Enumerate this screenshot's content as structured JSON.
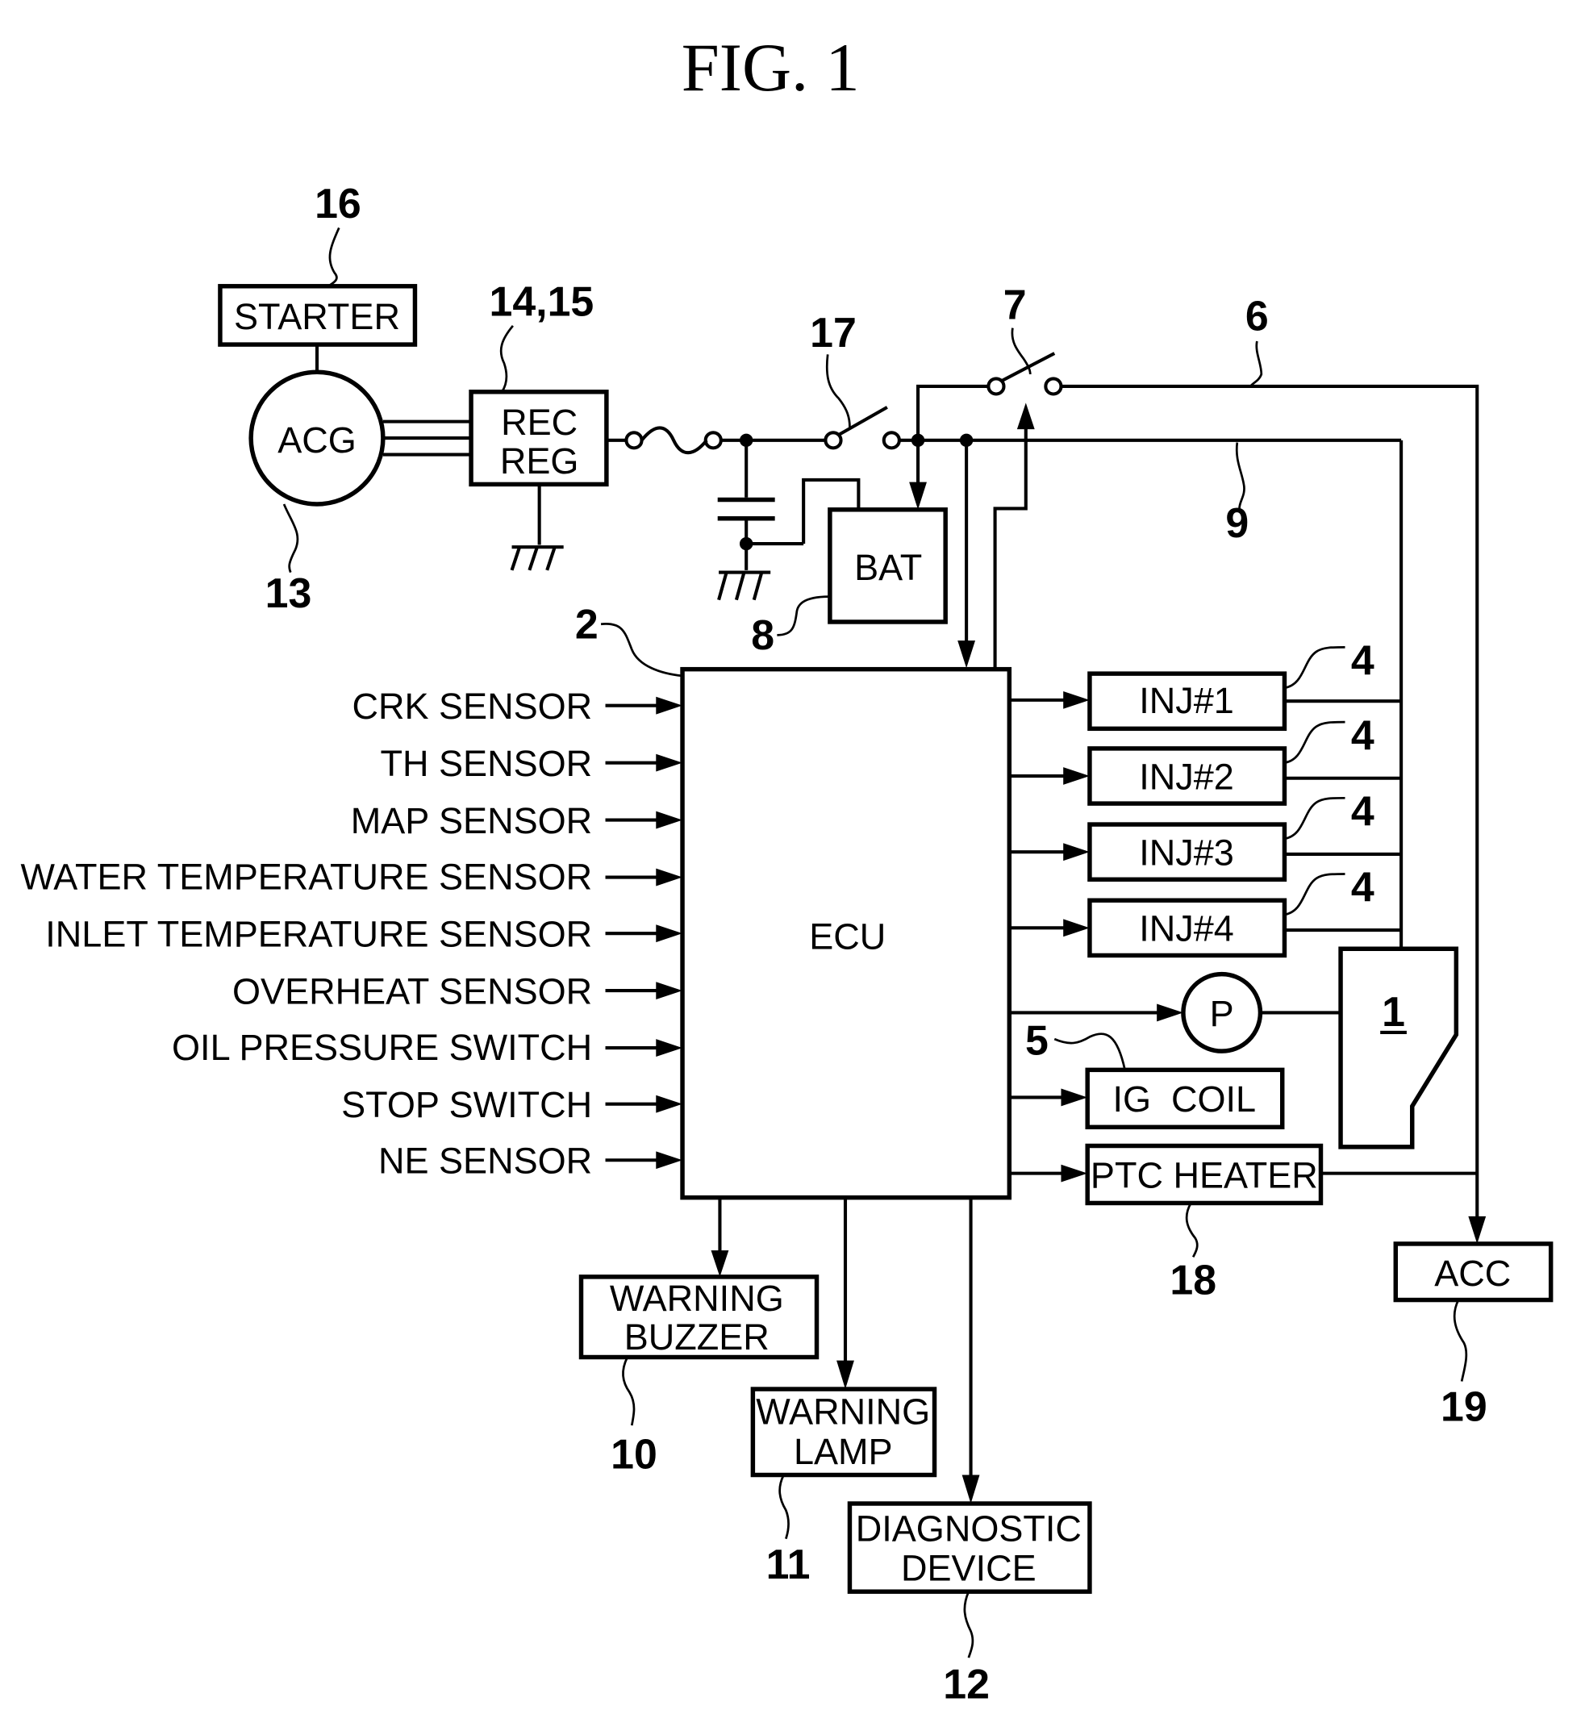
{
  "figure": {
    "title": "FIG. 1"
  },
  "components": {
    "starter": {
      "label": "STARTER",
      "ref": "16"
    },
    "acg": {
      "label": "ACG",
      "ref": "13"
    },
    "recreg": {
      "line1": "REC",
      "line2": "REG",
      "ref": "14,15"
    },
    "main_switch": {
      "ref": "17"
    },
    "ignition_switch": {
      "ref": "7"
    },
    "line6": {
      "ref": "6"
    },
    "line9": {
      "ref": "9"
    },
    "battery": {
      "label": "BAT",
      "ref": "8"
    },
    "ecu": {
      "label": "ECU",
      "ref": "2"
    },
    "injectors": [
      {
        "label": "INJ#1",
        "ref": "4"
      },
      {
        "label": "INJ#2",
        "ref": "4"
      },
      {
        "label": "INJ#3",
        "ref": "4"
      },
      {
        "label": "INJ#4",
        "ref": "4"
      }
    ],
    "pump": {
      "label": "P"
    },
    "engine": {
      "label": "1"
    },
    "ig_coil": {
      "label": "IG  COIL",
      "ref": "5"
    },
    "ptc_heater": {
      "label": "PTC HEATER",
      "ref": "18"
    },
    "acc": {
      "label": "ACC",
      "ref": "19"
    },
    "warning_buzzer": {
      "line1": "WARNING",
      "line2": "BUZZER",
      "ref": "10"
    },
    "warning_lamp": {
      "line1": "WARNING",
      "line2": "LAMP",
      "ref": "11"
    },
    "diagnostic_device": {
      "line1": "DIAGNOSTIC",
      "line2": "DEVICE",
      "ref": "12"
    }
  },
  "inputs": [
    "CRK SENSOR",
    "TH SENSOR",
    "MAP SENSOR",
    "WATER TEMPERATURE SENSOR",
    "INLET TEMPERATURE SENSOR",
    "OVERHEAT SENSOR",
    "OIL PRESSURE SWITCH",
    "STOP SWITCH",
    "NE SENSOR"
  ]
}
